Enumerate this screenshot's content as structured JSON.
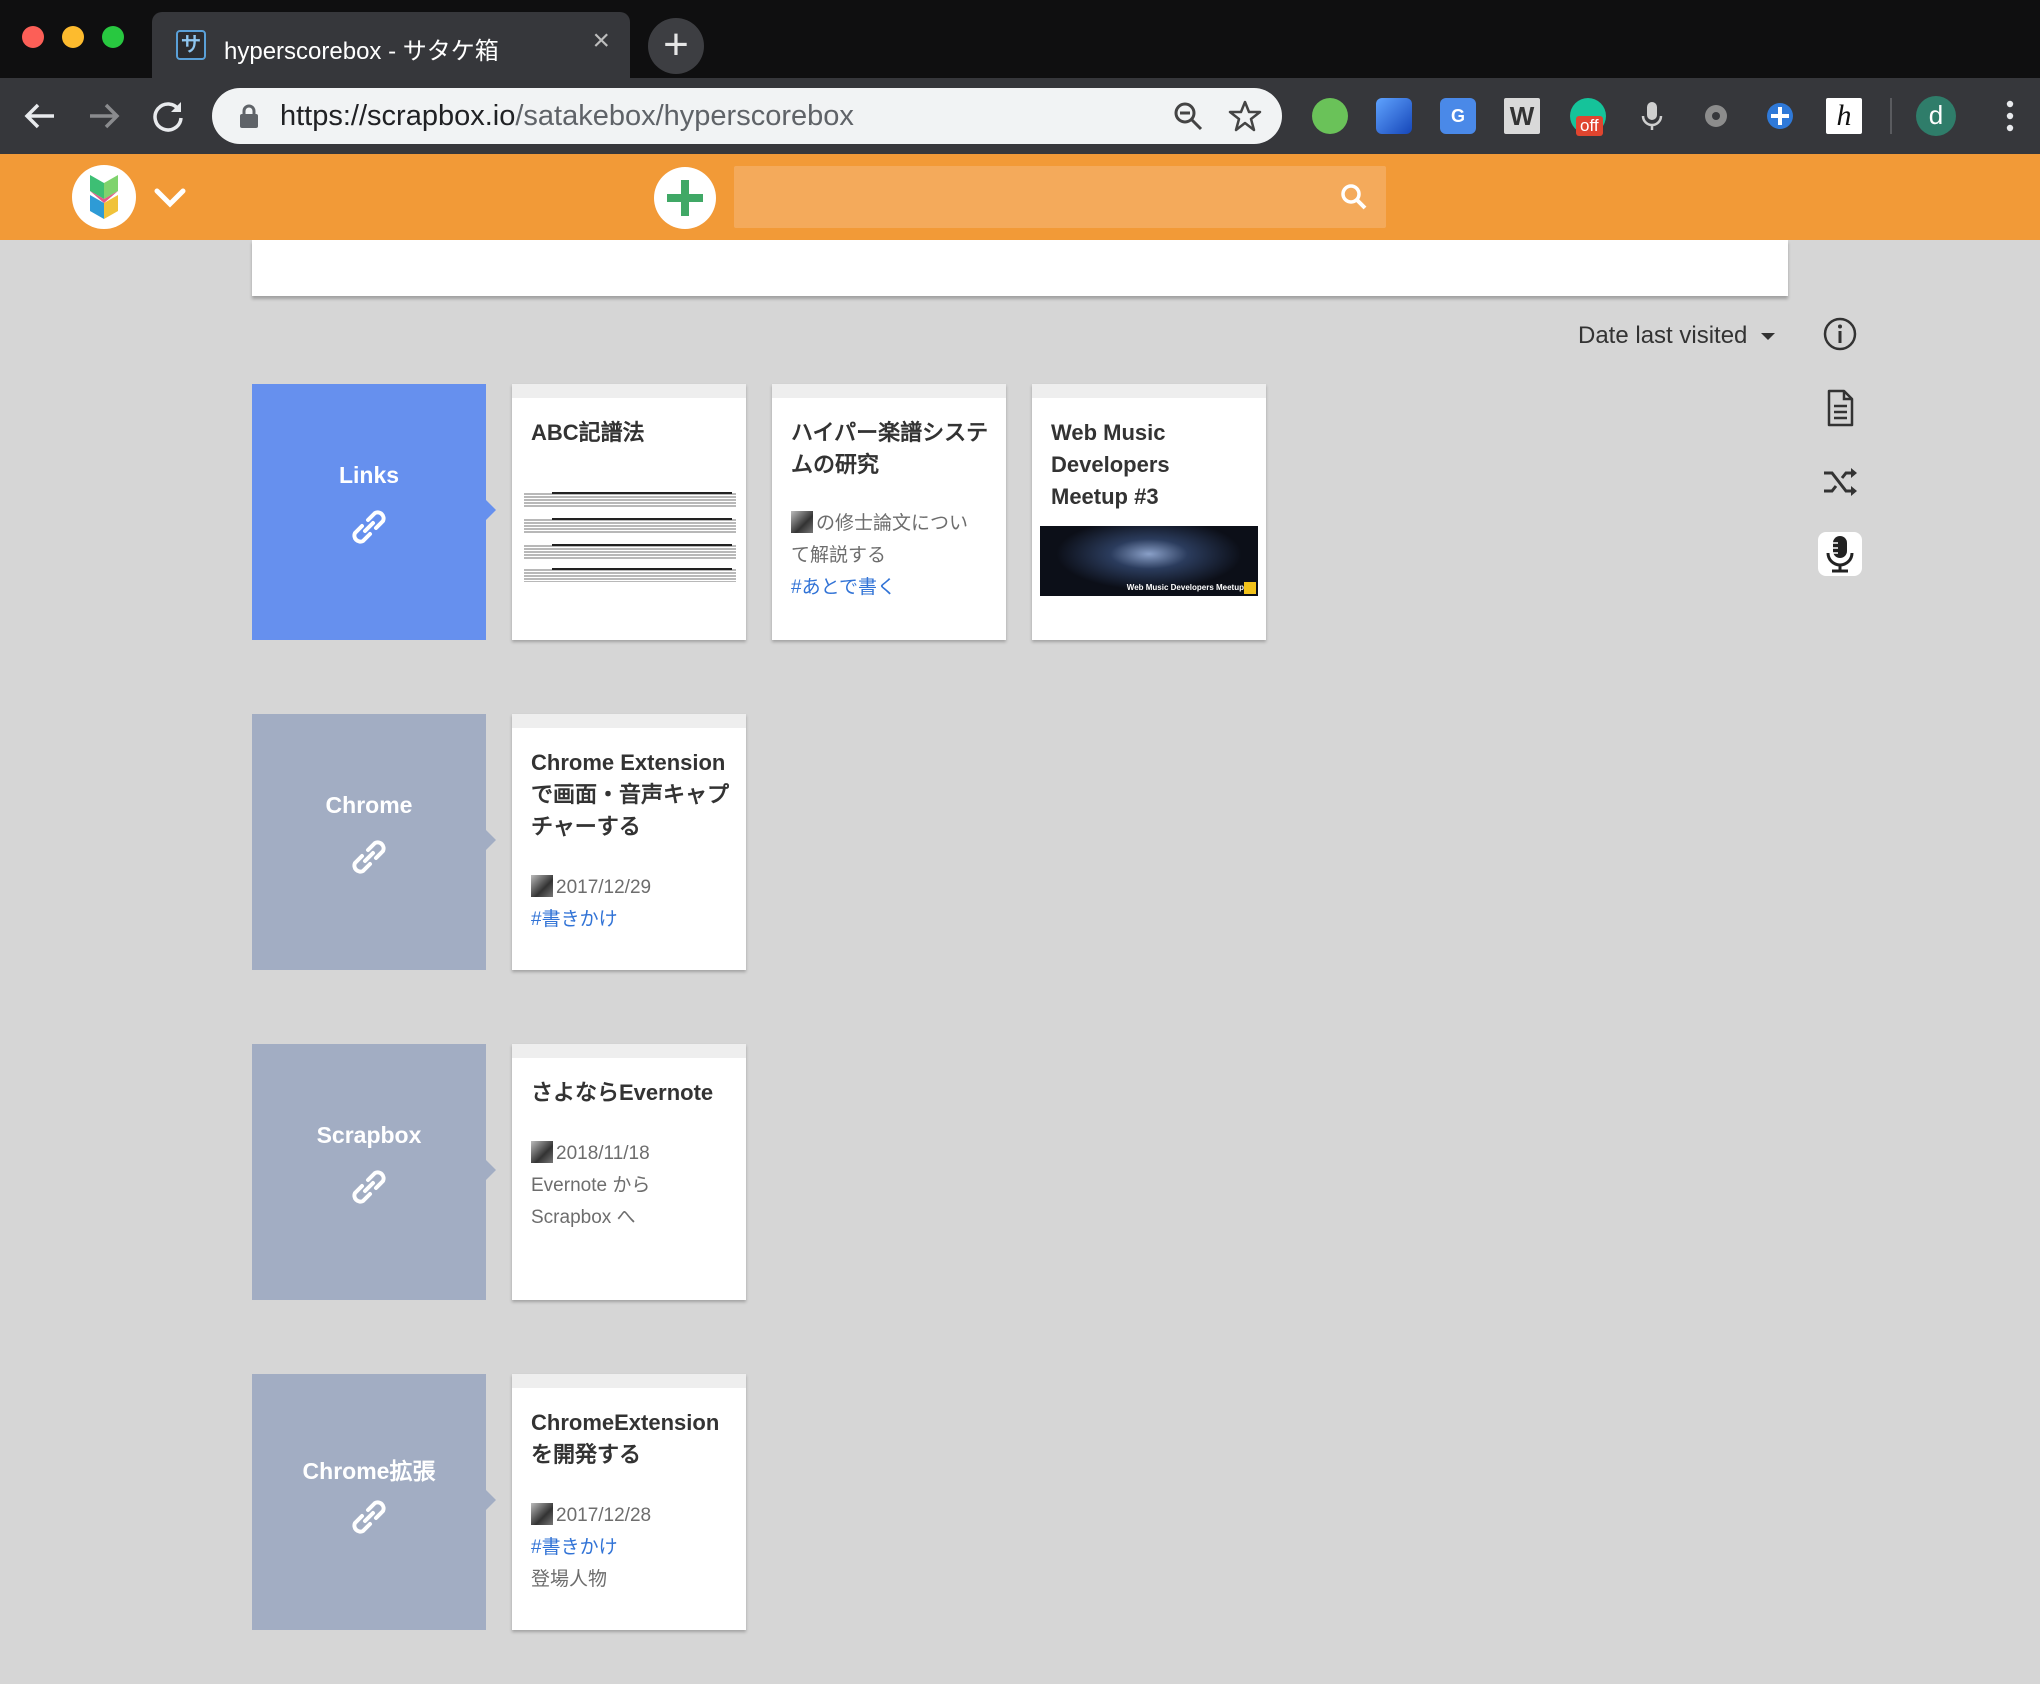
{
  "browser": {
    "tab_title": "hyperscorebox - サタケ箱",
    "tab_favicon_glyph": "サ",
    "url_host": "https://scrapbox.io",
    "url_path": "/satakebox/hyperscorebox",
    "extensions": [
      "evernote-icon",
      "blue-ext-icon",
      "google-translate-icon",
      "w-ext-icon",
      "grammar-off-icon",
      "mic-ext-icon",
      "dots-ext-icon",
      "puzzle-ext-icon",
      "hypothesis-icon"
    ],
    "extension_badge": "off",
    "profile_initial": "d"
  },
  "scrapbox": {
    "search_placeholder": "",
    "sort_label": "Date last visited"
  },
  "groups": [
    {
      "label": "Links",
      "cards": [
        {
          "title": "ABC記譜法",
          "image": "sheet-music"
        },
        {
          "title": "ハイパー楽譜システムの研究",
          "lines": [
            {
              "text": "の修士論文につい",
              "avatar": true
            },
            {
              "text": "て解説する"
            },
            {
              "text": "#あとで書く",
              "link": true
            }
          ]
        },
        {
          "title": "Web Music Developers Meetup #3",
          "image": "concert-photo",
          "image_caption": "Web Music Developers Meetup"
        }
      ]
    },
    {
      "label": "Chrome",
      "cards": [
        {
          "title": "Chrome Extensionで画面・音声キャプチャーする",
          "lines": [
            {
              "text": "2017/12/29",
              "avatar": true
            },
            {
              "text": "#書きかけ",
              "link": true
            }
          ]
        }
      ]
    },
    {
      "label": "Scrapbox",
      "cards": [
        {
          "title": "さよならEvernote",
          "lines": [
            {
              "text": "2018/11/18",
              "avatar": true
            },
            {
              "text": "Evernote から"
            },
            {
              "text": "Scrapbox へ"
            }
          ]
        }
      ]
    },
    {
      "label": "Chrome拡張",
      "cards": [
        {
          "title": "ChromeExtensionを開発する",
          "lines": [
            {
              "text": "2017/12/28",
              "avatar": true
            },
            {
              "text": "#書きかけ",
              "link": true
            },
            {
              "text": "登場人物"
            }
          ]
        }
      ]
    }
  ],
  "colors": {
    "header_orange": "#f29a37",
    "links_blue": "#6690ee",
    "group_gray": "#a2adc3",
    "hashtag_blue": "#3173d6"
  }
}
